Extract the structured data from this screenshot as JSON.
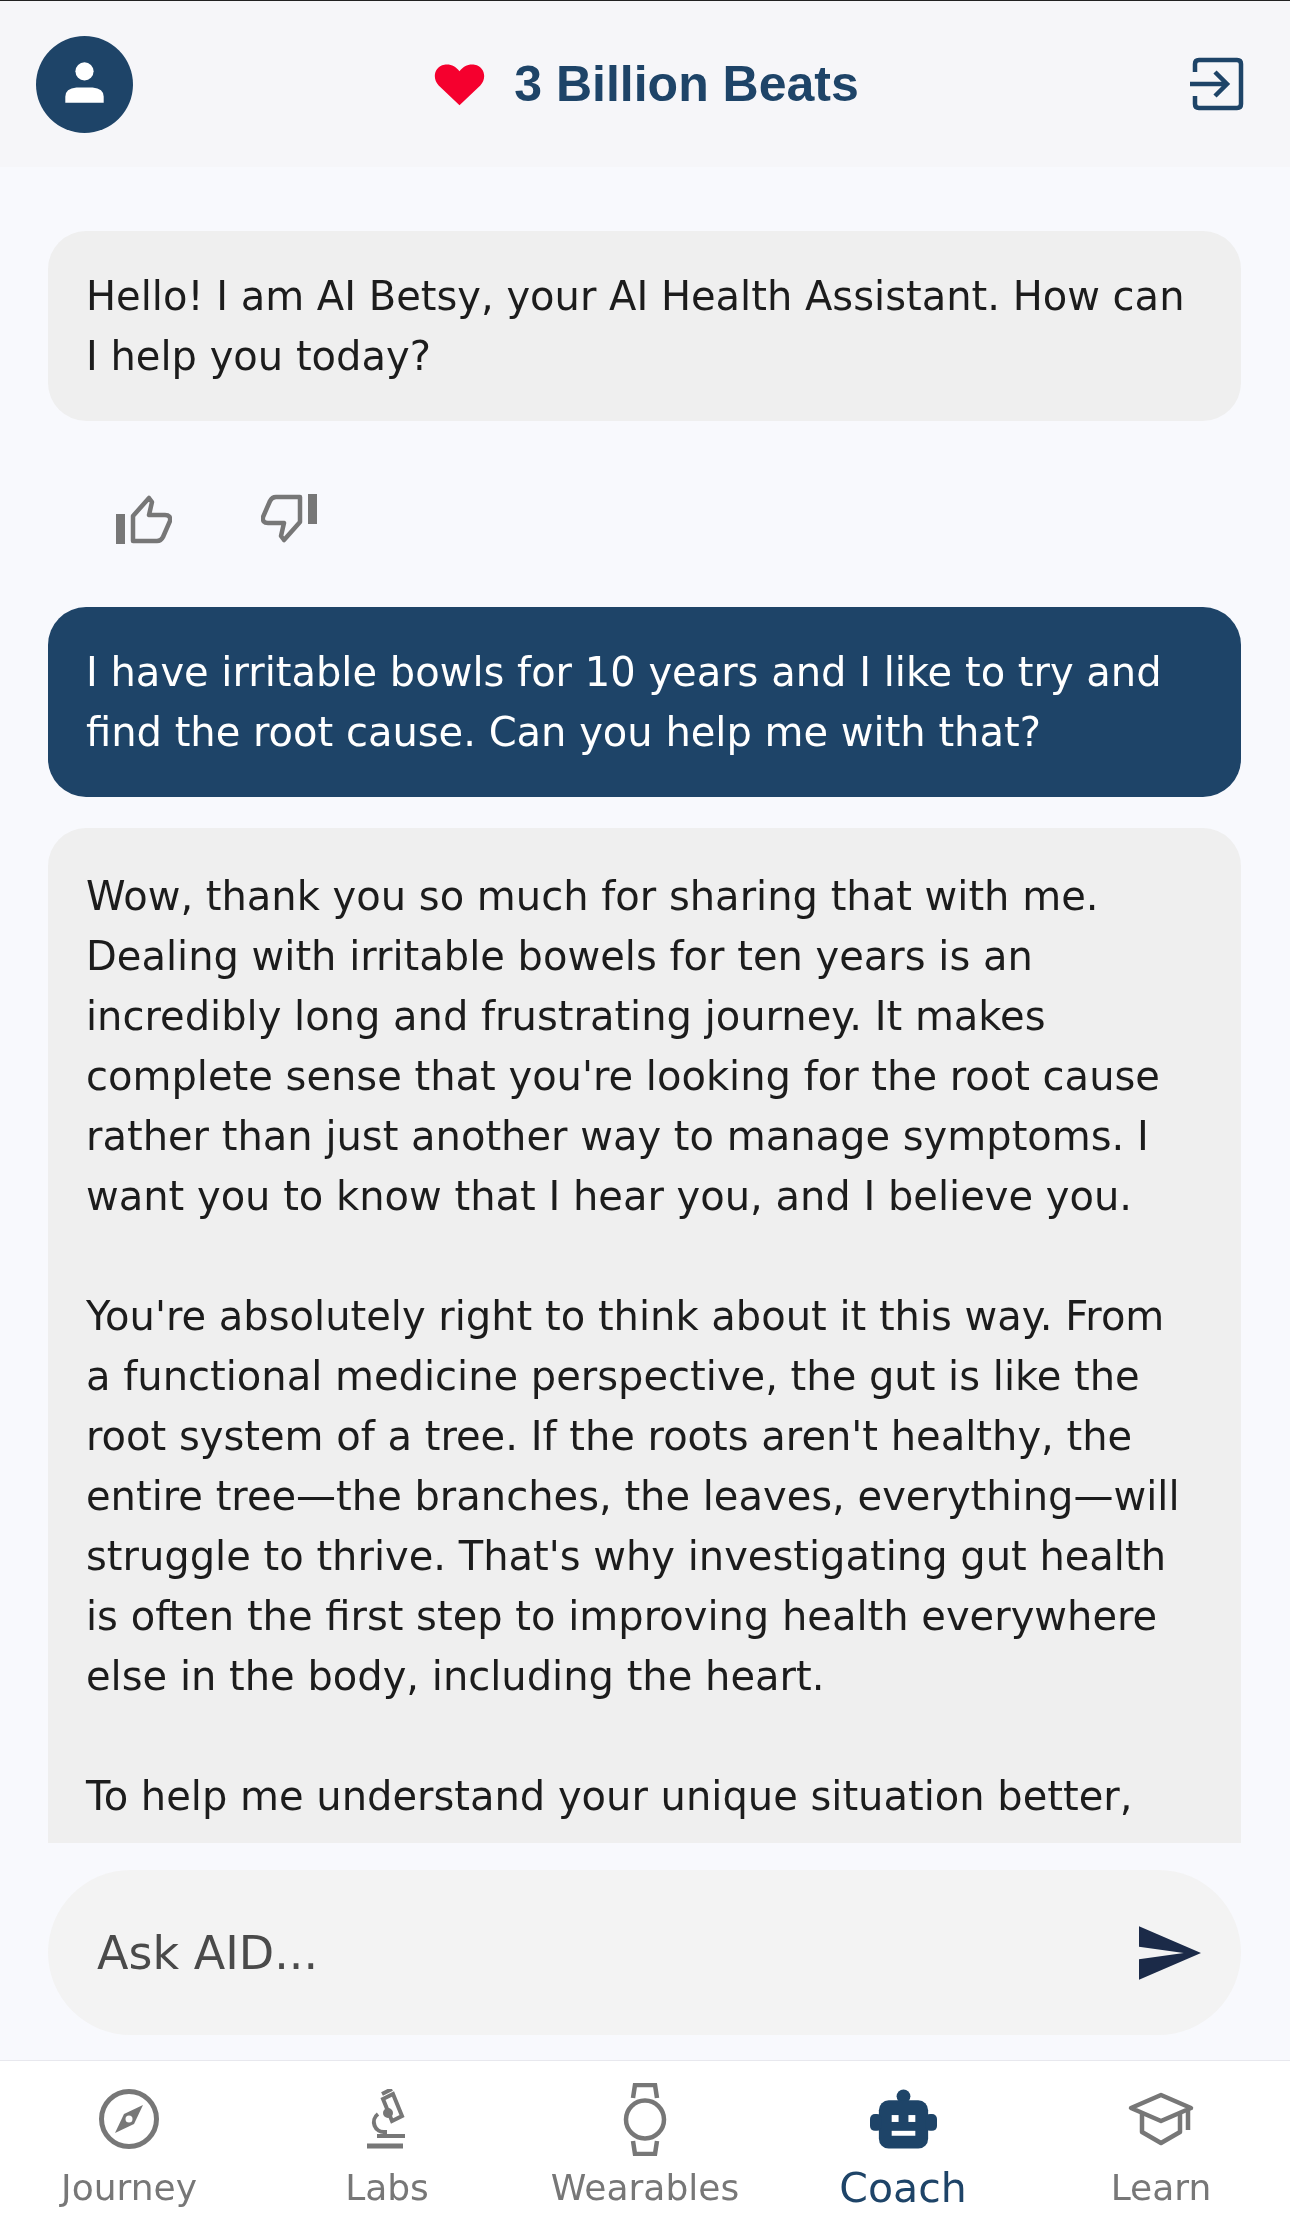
{
  "header": {
    "title": "3 Billion Beats"
  },
  "messages": [
    {
      "kind": "assistant",
      "paragraphs": [
        "Hello! I am AI Betsy, your AI Health Assistant. How can I help you today?"
      ]
    },
    {
      "kind": "feedback"
    },
    {
      "kind": "user",
      "paragraphs": [
        "I have irritable bowls for 10 years and I like to try and find the root cause. Can you help me with that?"
      ]
    },
    {
      "kind": "assistant",
      "paragraphs": [
        "Wow, thank you so much for sharing that with me. Dealing with irritable bowels for ten years is an incredibly long and frustrating journey. It makes complete sense that you're looking for the root cause rather than just another way to manage symptoms. I want you to know that I hear you, and I believe you.",
        "You're absolutely right to think about it this way. From a functional medicine perspective, the gut is like the root system of a tree. If the roots aren't healthy, the entire tree—the branches, the leaves, everything—will struggle to thrive. That's why investigating gut health is often the first step to improving health everywhere else in the body, including the heart.",
        "To help me understand your unique situation better,"
      ]
    }
  ],
  "composer": {
    "placeholder": "Ask AID..."
  },
  "nav": [
    {
      "label": "Journey",
      "selected": false
    },
    {
      "label": "Labs",
      "selected": false
    },
    {
      "label": "Wearables",
      "selected": false
    },
    {
      "label": "Coach",
      "selected": true
    },
    {
      "label": "Learn",
      "selected": false
    }
  ]
}
